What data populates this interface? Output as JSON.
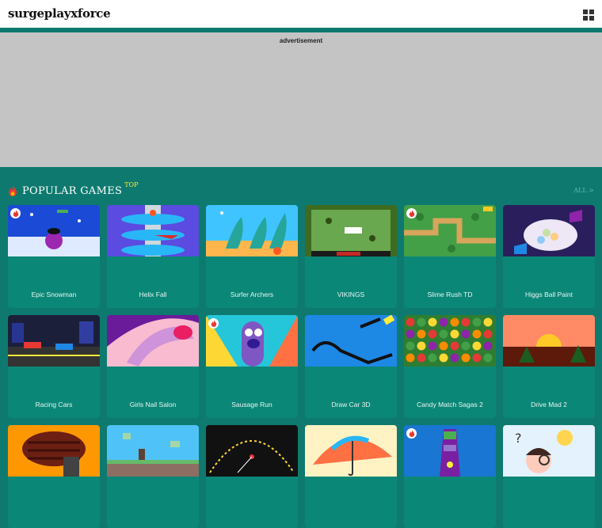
{
  "header": {
    "logo": "surgeplayxforce",
    "menu_icon": "grid-menu-icon"
  },
  "ad": {
    "label": "advertisement"
  },
  "popular": {
    "title": "POPULAR GAMES",
    "badge": "TOP",
    "all_link": "ALL >",
    "icon": "fire-icon"
  },
  "colors": {
    "brand": "#0e7a6f",
    "card": "#0b8777",
    "badge": "#ffeb3b",
    "hot_flame": "#e53935"
  },
  "games": [
    {
      "title": "Epic Snowman",
      "hot": true
    },
    {
      "title": "Helix Fall",
      "hot": false
    },
    {
      "title": "Surfer Archers",
      "hot": false
    },
    {
      "title": "VIKINGS",
      "hot": false
    },
    {
      "title": "Slime Rush TD",
      "hot": true
    },
    {
      "title": "Higgs Ball Paint",
      "hot": false
    },
    {
      "title": "Racing Cars",
      "hot": false
    },
    {
      "title": "Girls Nail Salon",
      "hot": false
    },
    {
      "title": "Sausage Run",
      "hot": true
    },
    {
      "title": "Draw Car 3D",
      "hot": false
    },
    {
      "title": "Candy Match Sagas 2",
      "hot": false
    },
    {
      "title": "Drive Mad 2",
      "hot": false
    },
    {
      "title": "",
      "hot": false
    },
    {
      "title": "",
      "hot": false
    },
    {
      "title": "",
      "hot": false
    },
    {
      "title": "",
      "hot": false
    },
    {
      "title": "",
      "hot": true
    },
    {
      "title": "",
      "hot": false
    }
  ]
}
